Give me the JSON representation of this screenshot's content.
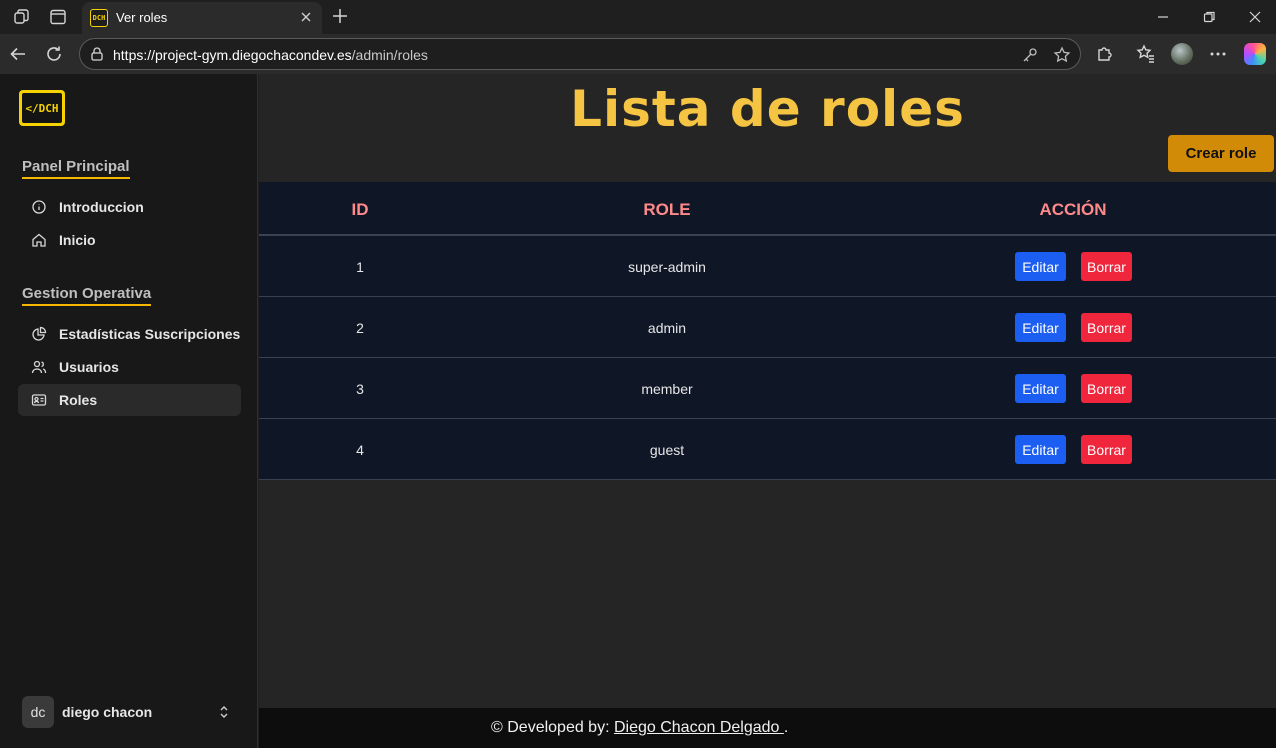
{
  "browser": {
    "tab_title": "Ver roles",
    "url_host": "https://project-gym.diegochacondev.es",
    "url_path": "/admin/roles"
  },
  "sidebar": {
    "logo_text": "</DCH",
    "sections": [
      {
        "title": "Panel Principal",
        "items": [
          {
            "label": "Introduccion",
            "icon": "info-icon"
          },
          {
            "label": "Inicio",
            "icon": "home-icon"
          }
        ]
      },
      {
        "title": "Gestion Operativa",
        "items": [
          {
            "label": "Estadísticas Suscripciones",
            "icon": "chart-pie-icon"
          },
          {
            "label": "Usuarios",
            "icon": "users-icon"
          },
          {
            "label": "Roles",
            "icon": "id-card-icon",
            "active": true
          }
        ]
      }
    ],
    "user": {
      "initials": "dc",
      "name": "diego chacon"
    }
  },
  "main": {
    "title": "Lista de roles",
    "create_label": "Crear role",
    "table": {
      "headers": [
        "ID",
        "ROLE",
        "ACCIÓN"
      ],
      "rows": [
        {
          "id": "1",
          "role": "super-admin"
        },
        {
          "id": "2",
          "role": "admin"
        },
        {
          "id": "3",
          "role": "member"
        },
        {
          "id": "4",
          "role": "guest"
        }
      ],
      "edit_label": "Editar",
      "delete_label": "Borrar"
    }
  },
  "footer": {
    "prefix": "© Developed by: ",
    "author": "Diego Chacon Delgado ",
    "suffix": "."
  },
  "colors": {
    "accent": "#f5c442",
    "create_button": "#d18b06",
    "edit_button": "#1d5ef2",
    "delete_button": "#f0263d",
    "table_header_text": "#ff8a8a",
    "table_bg": "#0f1727"
  }
}
